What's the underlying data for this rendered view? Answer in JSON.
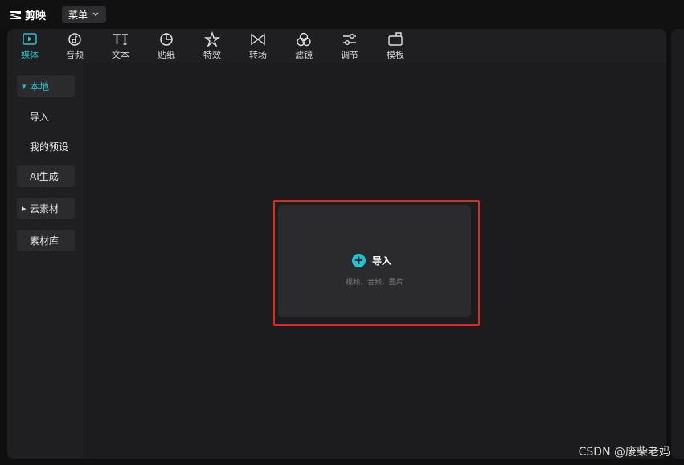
{
  "app": {
    "name": "剪映",
    "menu_label": "菜单"
  },
  "toolbar": {
    "items": [
      {
        "label": "媒体",
        "icon": "media-icon",
        "active": true
      },
      {
        "label": "音频",
        "icon": "audio-icon"
      },
      {
        "label": "文本",
        "icon": "text-icon"
      },
      {
        "label": "贴纸",
        "icon": "sticker-icon"
      },
      {
        "label": "特效",
        "icon": "effects-icon"
      },
      {
        "label": "转场",
        "icon": "transition-icon"
      },
      {
        "label": "滤镜",
        "icon": "filter-icon"
      },
      {
        "label": "调节",
        "icon": "adjust-icon"
      },
      {
        "label": "模板",
        "icon": "template-icon"
      }
    ]
  },
  "sidebar": {
    "items": [
      {
        "label": "本地",
        "active": true,
        "expanded": true
      },
      {
        "label": "导入"
      },
      {
        "label": "我的预设"
      },
      {
        "label": "AI生成"
      },
      {
        "label": "云素材",
        "collapsed": true
      },
      {
        "label": "素材库"
      }
    ]
  },
  "import_panel": {
    "label": "导入",
    "subtitle": "视频、音频、图片"
  },
  "watermark": "CSDN @废柴老妈",
  "colors": {
    "accent": "#22c5cf",
    "highlight": "#e8261c",
    "background": "#1c1c1e"
  }
}
